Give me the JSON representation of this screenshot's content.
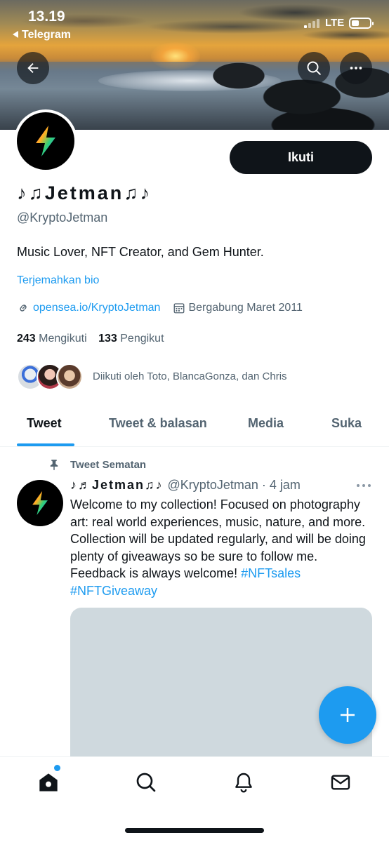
{
  "status_bar": {
    "time": "13.19",
    "back_app": "Telegram",
    "network": "LTE"
  },
  "profile": {
    "name": "♪♫Jetman♫♪",
    "handle": "@KryptoJetman",
    "bio": "Music Lover, NFT Creator, and Gem Hunter.",
    "translate_label": "Terjemahkan bio",
    "website": "opensea.io/KryptoJetman",
    "joined": "Bergabung Maret 2011",
    "following_count": "243",
    "following_label": "Mengikuti",
    "followers_count": "133",
    "followers_label": "Pengikut",
    "followed_by": "Diikuti oleh Toto, BlancaGonza, dan Chris",
    "follow_button": "Ikuti"
  },
  "tabs": [
    {
      "label": "Tweet",
      "active": true
    },
    {
      "label": "Tweet & balasan",
      "active": false
    },
    {
      "label": "Media",
      "active": false
    },
    {
      "label": "Suka",
      "active": false
    }
  ],
  "pinned_tweet": {
    "pinned_label": "Tweet Sematan",
    "author_name": "♪♬Jetman♫♪",
    "author_handle": "@KryptoJetman",
    "time": "· 4 jam",
    "text": "Welcome to my collection! Focused on photography art: real world experiences, music, nature, and more. Collection will be updated regularly, and will be doing plenty of giveaways so be sure to follow me. Feedback is always welcome!",
    "hashtag_1": "#NFTsales",
    "hashtag_2": "#NFTGiveaway"
  },
  "colors": {
    "accent": "#1d9bf0",
    "text_primary": "#0f1419",
    "text_secondary": "#536471",
    "media_placeholder": "#cfd9de"
  },
  "icons": {
    "back": "arrow-left-icon",
    "search": "search-icon",
    "more": "more-horizontal-icon",
    "link": "link-icon",
    "calendar": "calendar-icon",
    "pin": "pin-icon",
    "compose": "plus-icon",
    "home": "home-icon",
    "explore": "search-icon",
    "notifications": "bell-icon",
    "messages": "mail-icon"
  }
}
